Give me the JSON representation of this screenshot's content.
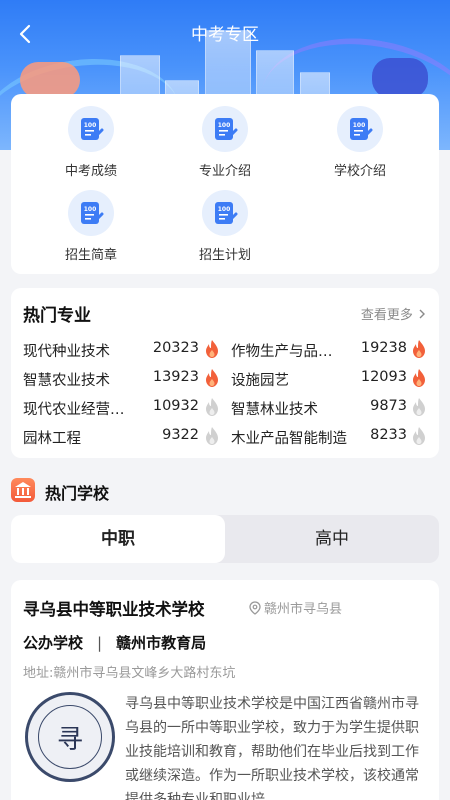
{
  "header": {
    "title": "中考专区"
  },
  "menu": [
    {
      "label": "中考成绩",
      "icon": "score-doc-icon"
    },
    {
      "label": "专业介绍",
      "icon": "major-doc-icon"
    },
    {
      "label": "学校介绍",
      "icon": "school-doc-icon"
    },
    {
      "label": "招生简章",
      "icon": "brochure-doc-icon"
    },
    {
      "label": "招生计划",
      "icon": "plan-doc-icon"
    }
  ],
  "hot_majors": {
    "title": "热门专业",
    "more_label": "查看更多",
    "items": [
      {
        "name": "现代种业技术",
        "count": "20323",
        "hot": true
      },
      {
        "name": "作物生产与品…",
        "count": "19238",
        "hot": true
      },
      {
        "name": "智慧农业技术",
        "count": "13923",
        "hot": true
      },
      {
        "name": "设施园艺",
        "count": "12093",
        "hot": true
      },
      {
        "name": "现代农业经营…",
        "count": "10932",
        "hot": false
      },
      {
        "name": "智慧林业技术",
        "count": "9873",
        "hot": false
      },
      {
        "name": "园林工程",
        "count": "9322",
        "hot": false
      },
      {
        "name": "木业产品智能制造",
        "count": "8233",
        "hot": false
      }
    ]
  },
  "hot_schools": {
    "title": "热门学校",
    "tabs": [
      {
        "label": "中职"
      },
      {
        "label": "高中"
      }
    ],
    "active_tab": 0
  },
  "school": {
    "name": "寻乌县中等职业技术学校",
    "location": "赣州市寻乌县",
    "type": "公办学校",
    "authority": "赣州市教育局",
    "address": "地址:赣州市寻乌县文峰乡大路村东坑",
    "logo_char": "寻",
    "description": "寻乌县中等职业技术学校是中国江西省赣州市寻乌县的一所中等职业学校，致力于为学生提供职业技能培训和教育，帮助他们在毕业后找到工作或继续深造。作为一所职业技术学校，该校通常提供多种专业和职业培…"
  },
  "colors": {
    "hot_flame": "#f2603a",
    "cold_flame": "#c8c8c8",
    "icon_blue": "#3d7cf5",
    "icon_bg": "#e6effd"
  }
}
